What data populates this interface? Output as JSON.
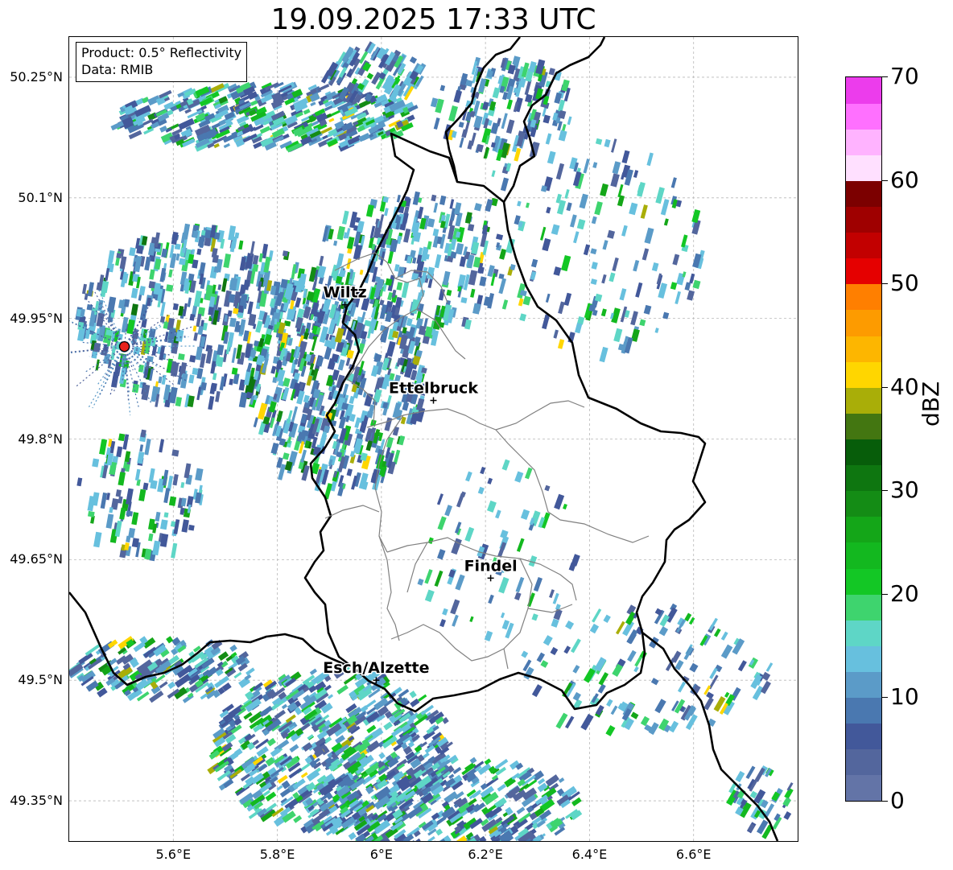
{
  "title": "19.09.2025 17:33 UTC",
  "info": {
    "product": "Product: 0.5° Reflectivity",
    "data_source": "Data: RMIB"
  },
  "map": {
    "lon_range": [
      5.4,
      6.8
    ],
    "lat_range": [
      49.3,
      50.3
    ],
    "lat_ticks": [
      {
        "value": 50.25,
        "label": "50.25°N"
      },
      {
        "value": 50.1,
        "label": "50.1°N"
      },
      {
        "value": 49.95,
        "label": "49.95°N"
      },
      {
        "value": 49.8,
        "label": "49.8°N"
      },
      {
        "value": 49.65,
        "label": "49.65°N"
      },
      {
        "value": 49.5,
        "label": "49.5°N"
      },
      {
        "value": 49.35,
        "label": "49.35°N"
      }
    ],
    "lon_ticks": [
      {
        "value": 5.6,
        "label": "5.6°E"
      },
      {
        "value": 5.8,
        "label": "5.8°E"
      },
      {
        "value": 6.0,
        "label": "6°E"
      },
      {
        "value": 6.2,
        "label": "6.2°E"
      },
      {
        "value": 6.4,
        "label": "6.4°E"
      },
      {
        "value": 6.6,
        "label": "6.6°E"
      }
    ],
    "cities": [
      {
        "name": "Wiltz",
        "lon": 5.93,
        "lat": 49.967
      },
      {
        "name": "Ettelbruck",
        "lon": 6.1,
        "lat": 49.848
      },
      {
        "name": "Findel",
        "lon": 6.21,
        "lat": 49.627
      },
      {
        "name": "Esch/Alzette",
        "lon": 5.99,
        "lat": 49.5
      }
    ],
    "radar_site": {
      "lon": 5.506,
      "lat": 49.915,
      "color": "#e8231c"
    }
  },
  "colorbar": {
    "label": "dBZ",
    "min": 0,
    "max": 70,
    "ticks": [
      "0",
      "10",
      "20",
      "30",
      "40",
      "50",
      "60",
      "70"
    ],
    "colors": [
      "#6374a7",
      "#53669d",
      "#42589a",
      "#4a78b0",
      "#5b9bc8",
      "#67c0de",
      "#5ed6c6",
      "#3ed46e",
      "#13c725",
      "#13b81f",
      "#14a618",
      "#148c15",
      "#0e7610",
      "#075d0a",
      "#437611",
      "#a9ae08",
      "#ffd600",
      "#fdb600",
      "#fd9b00",
      "#ff7f00",
      "#e50000",
      "#c20000",
      "#9f0000",
      "#7c0000",
      "#ffe0ff",
      "#ffb3ff",
      "#ff70ff",
      "#ec3cec"
    ]
  }
}
